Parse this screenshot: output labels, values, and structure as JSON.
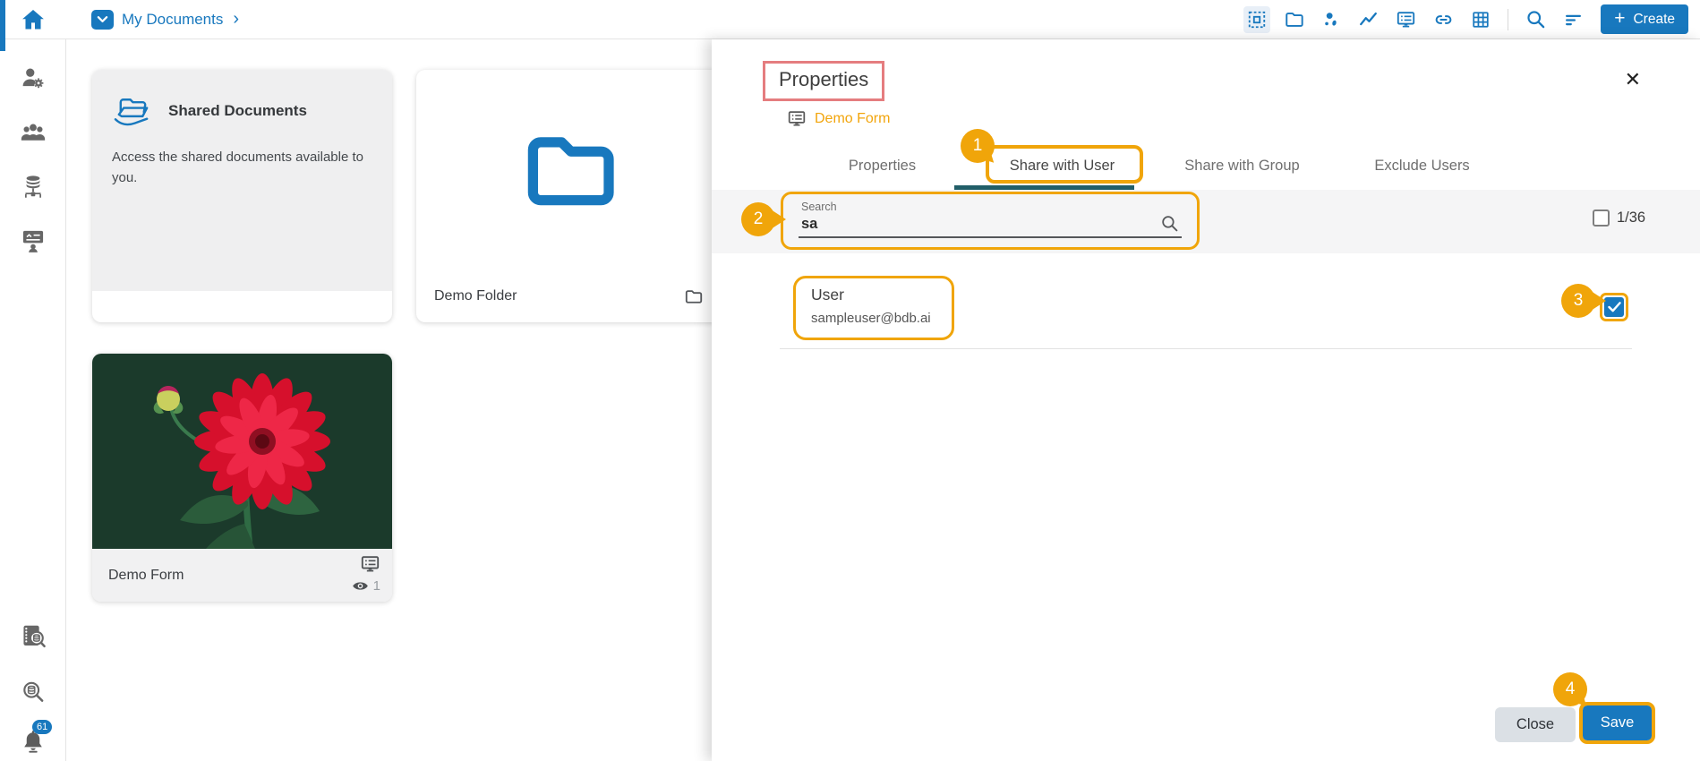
{
  "colors": {
    "accent_blue": "#1878be",
    "annotation_orange": "#f0a50a",
    "title_highlight_red": "#e57d7f",
    "tab_indicator_teal": "#215e68",
    "flower_card_green": "#1b3a2b"
  },
  "topbar": {
    "breadcrumb_label": "My Documents",
    "breadcrumb_chevron": "›",
    "create_plus": "+",
    "create_label": "Create"
  },
  "sidebar": {
    "notification_count": "61"
  },
  "cards": {
    "shared": {
      "title": "Shared Documents",
      "description": "Access the shared documents available to you."
    },
    "folder": {
      "title": "Demo Folder"
    },
    "form": {
      "title": "Demo Form",
      "views": "1"
    }
  },
  "panel": {
    "title": "Properties",
    "resource_name": "Demo Form",
    "close_glyph": "✕",
    "tabs": [
      {
        "label": "Properties"
      },
      {
        "label": "Share with User"
      },
      {
        "label": "Share with Group"
      },
      {
        "label": "Exclude Users"
      }
    ],
    "search": {
      "label": "Search",
      "value": "sa"
    },
    "selection_count": "1/36",
    "user": {
      "name": "User",
      "email": "sampleuser@bdb.ai"
    },
    "buttons": {
      "close": "Close",
      "save": "Save"
    }
  },
  "annotations": {
    "step1": "1",
    "step2": "2",
    "step3": "3",
    "step4": "4"
  }
}
